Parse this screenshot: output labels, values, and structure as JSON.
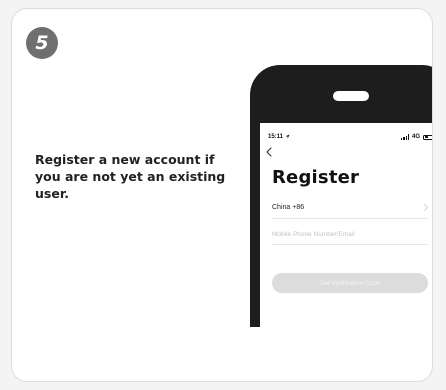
{
  "step": {
    "number": "5"
  },
  "instruction": {
    "text": "Register a new account if you are not yet an existing user."
  },
  "phone_screen": {
    "status_bar": {
      "time": "15:11",
      "network": "4G"
    },
    "title": "Register",
    "country": {
      "label": "China +86"
    },
    "account_input": {
      "placeholder": "Mobile Phone Number/Email",
      "value": ""
    },
    "verify_button": {
      "label": "Get Verification Code"
    }
  },
  "colors": {
    "badge": "#6f6f6f",
    "phone_frame": "#1d1d1d",
    "button_disabled": "#dcdcdc",
    "card_border": "#dcdcdc"
  },
  "icons": {
    "location": "location-arrow-icon",
    "signal": "signal-icon",
    "battery": "battery-icon",
    "back": "chevron-left-icon",
    "country_arrow": "chevron-right-icon"
  }
}
